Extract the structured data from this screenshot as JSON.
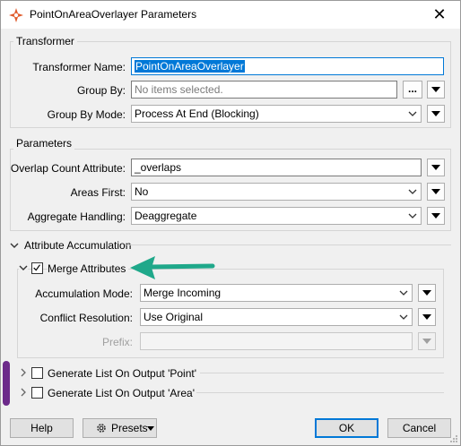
{
  "window": {
    "title": "PointOnAreaOverlayer Parameters",
    "close_glyph": "✕"
  },
  "transformer": {
    "legend": "Transformer",
    "name_label": "Transformer Name:",
    "name_value": "PointOnAreaOverlayer",
    "group_by_label": "Group By:",
    "group_by_placeholder": "No items selected.",
    "group_by_ellipsis": "...",
    "group_by_mode_label": "Group By Mode:",
    "group_by_mode_value": "Process At End (Blocking)"
  },
  "parameters": {
    "legend": "Parameters",
    "overlap_label": "Overlap Count Attribute:",
    "overlap_value": "_overlaps",
    "areas_first_label": "Areas First:",
    "areas_first_value": "No",
    "aggregate_label": "Aggregate Handling:",
    "aggregate_value": "Deaggregate"
  },
  "accumulation": {
    "legend": "Attribute Accumulation",
    "merge_label": "Merge Attributes",
    "merge_checked": true,
    "mode_label": "Accumulation Mode:",
    "mode_value": "Merge Incoming",
    "conflict_label": "Conflict Resolution:",
    "conflict_value": "Use Original",
    "prefix_label": "Prefix:",
    "prefix_value": ""
  },
  "lists": {
    "point_label": "Generate List On Output 'Point'",
    "area_label": "Generate List On Output 'Area'"
  },
  "footer": {
    "help_label": "Help",
    "presets_label": "Presets",
    "ok_label": "OK",
    "cancel_label": "Cancel"
  },
  "colors": {
    "annotation_arrow": "#1fa88a",
    "annotation_bar": "#6c2a8a",
    "selection": "#0078d7"
  },
  "icons": {
    "app": "fme-transformer-icon",
    "presets": "gear-icon"
  }
}
